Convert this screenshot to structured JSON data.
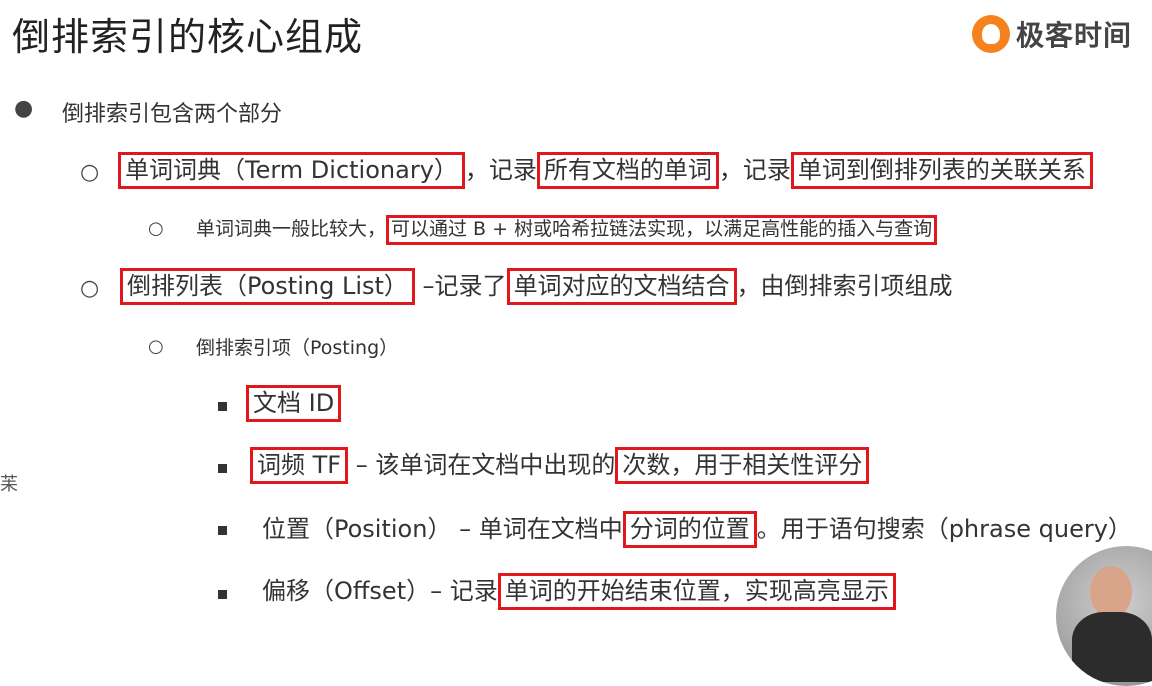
{
  "title": "倒排索引的核心组成",
  "logo": {
    "text": "极客时间"
  },
  "bullet": "倒排索引包含两个部分",
  "term_dict": {
    "boxed": "单词词典（Term Dictionary）",
    "mid1": "，记录",
    "boxed2": "所有文档的单词",
    "mid2": "，记录",
    "boxed3": "单词到倒排列表的关联关系"
  },
  "term_dict_sub": {
    "plain": "单词词典一般比较大，",
    "boxed": "可以通过 B + 树或哈希拉链法实现，以满足高性能的插入与查询"
  },
  "posting_list": {
    "boxed": "倒排列表（Posting List）",
    "mid": " –记录了",
    "boxed2": "单词对应的文档结合",
    "tail": "，由倒排索引项组成"
  },
  "posting": {
    "text": "倒排索引项（Posting）"
  },
  "items": {
    "doc_id": {
      "boxed": "文档 ID"
    },
    "tf": {
      "boxed": "词频 TF",
      "mid": " – 该单词在文档中出现的",
      "boxed2": "次数，用于相关性评分"
    },
    "position": {
      "plain": "位置（Position） – 单词在文档中",
      "boxed": "分词的位置",
      "tail": "。用于语句搜索（phrase query）"
    },
    "offset": {
      "plain": "偏移（Offset）– 记录",
      "boxed": "单词的开始结束位置，实现高亮显示"
    }
  },
  "edge_mark": "苿",
  "colors": {
    "highlight_border": "#e0181b",
    "logo_orange": "#f5821f"
  }
}
